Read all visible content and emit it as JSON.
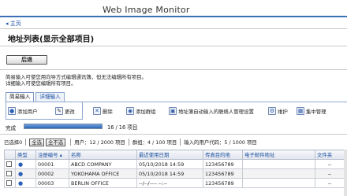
{
  "brand": "Web Image Monitor",
  "nav": {
    "home": "◂ 主页"
  },
  "page_title": "地址列表(显示全部项目)",
  "back_label": "后退",
  "notice": {
    "line1": "简易输入可使您用向导方式编辑通讯簿，但无法编辑所有项目。",
    "line2": "详细输入可使您编辑所有项目。"
  },
  "tabs": [
    {
      "label": "简易输入",
      "active": true
    },
    {
      "label": "详细输入",
      "active": false
    }
  ],
  "toolbar": {
    "add_user": "添加用户",
    "edit": "更改",
    "delete": "删除",
    "add_group": "添加群组",
    "auto_register": "地址簿自动输入的联络人管理设置",
    "maintenance": "维护",
    "central": "集中管理"
  },
  "progress": {
    "label": "完成",
    "count": "16 / 16 项目",
    "fraction": 1.0
  },
  "status": {
    "selected": "已选择0",
    "select_all": "全选",
    "deselect_all": "全不选",
    "users": "用户：12 / 2000 项目",
    "groups": "群组：4 / 100 项目",
    "codes": "输入的用户代码：5 / 1000 项目"
  },
  "table": {
    "headers": [
      "",
      "类型",
      "注册编号 ▴",
      "名称",
      "最近使用日期",
      "传真目的地",
      "电子邮件地址",
      "文件夹"
    ],
    "rows": [
      {
        "reg": "00001",
        "name": "ABCD COMPANY",
        "date": "05/10/2018 14:59",
        "fax": "123456789",
        "email": "",
        "folder": "--"
      },
      {
        "reg": "00002",
        "name": "YOKOHAMA OFFICE",
        "date": "05/10/2018 14:59",
        "fax": "123456789",
        "email": "",
        "folder": "--"
      },
      {
        "reg": "00003",
        "name": "BERLIN OFFICE",
        "date": "--/--/---- --:--",
        "fax": "123456789",
        "email": "",
        "folder": "--"
      }
    ]
  },
  "colors": {
    "accent": "#3b6fb6",
    "link": "#1a4fa0"
  },
  "icons": [
    "user-icon",
    "edit-icon",
    "delete-icon",
    "group-icon",
    "book-icon",
    "wrench-icon",
    "network-icon"
  ]
}
